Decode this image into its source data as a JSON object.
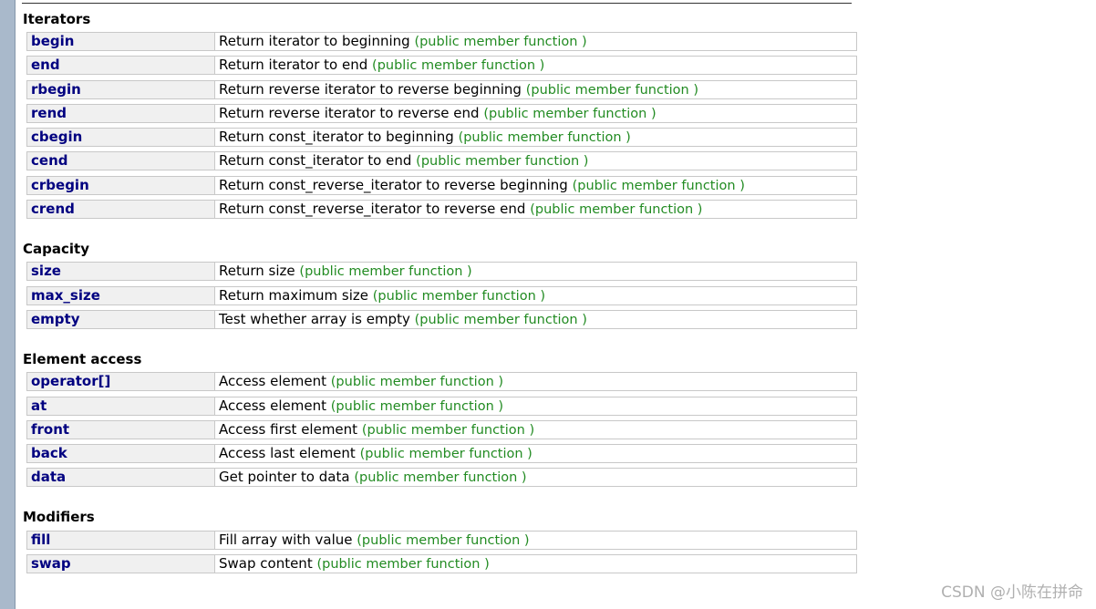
{
  "sections": [
    {
      "title": "Iterators",
      "rows": [
        {
          "name": "begin",
          "desc": "Return iterator to beginning",
          "type": "(public member function )"
        },
        {
          "name": "end",
          "desc": "Return iterator to end",
          "type": "(public member function )"
        },
        {
          "name": "rbegin",
          "desc": "Return reverse iterator to reverse beginning",
          "type": "(public member function )"
        },
        {
          "name": "rend",
          "desc": "Return reverse iterator to reverse end",
          "type": "(public member function )"
        },
        {
          "name": "cbegin",
          "desc": "Return const_iterator to beginning",
          "type": "(public member function )"
        },
        {
          "name": "cend",
          "desc": "Return const_iterator to end",
          "type": "(public member function )"
        },
        {
          "name": "crbegin",
          "desc": "Return const_reverse_iterator to reverse beginning",
          "type": "(public member function )"
        },
        {
          "name": "crend",
          "desc": "Return const_reverse_iterator to reverse end",
          "type": "(public member function )"
        }
      ]
    },
    {
      "title": "Capacity",
      "rows": [
        {
          "name": "size",
          "desc": "Return size",
          "type": "(public member function )"
        },
        {
          "name": "max_size",
          "desc": "Return maximum size",
          "type": "(public member function )"
        },
        {
          "name": "empty",
          "desc": "Test whether array is empty",
          "type": "(public member function )"
        }
      ]
    },
    {
      "title": "Element access",
      "rows": [
        {
          "name": "operator[]",
          "desc": "Access element",
          "type": "(public member function )"
        },
        {
          "name": "at",
          "desc": "Access element",
          "type": "(public member function )"
        },
        {
          "name": "front",
          "desc": "Access first element",
          "type": "(public member function )"
        },
        {
          "name": "back",
          "desc": "Access last element",
          "type": "(public member function )"
        },
        {
          "name": "data",
          "desc": "Get pointer to data",
          "type": "(public member function )"
        }
      ]
    },
    {
      "title": "Modifiers",
      "rows": [
        {
          "name": "fill",
          "desc": "Fill array with value",
          "type": "(public member function )"
        },
        {
          "name": "swap",
          "desc": "Swap content",
          "type": "(public member function )"
        }
      ]
    }
  ],
  "watermark": "CSDN @⁣⁣小陈在拼命⁣⁣",
  "colors": {
    "name": "#000080",
    "type": "#228b22",
    "name_bg": "#f0f0f0",
    "border": "#c8c8c8",
    "left_strip": "#a9b9cb"
  }
}
